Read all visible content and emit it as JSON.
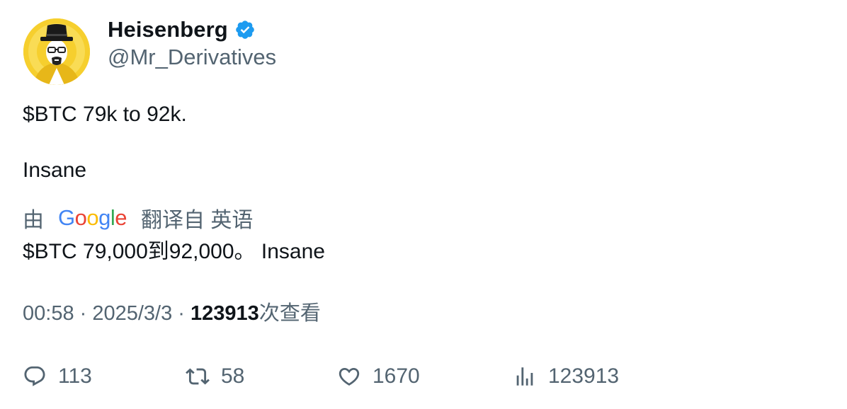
{
  "author": {
    "display_name": "Heisenberg",
    "handle": "@Mr_Derivatives",
    "verified": true,
    "verified_color": "#1d9bf0",
    "avatar_icon": "heisenberg-avatar"
  },
  "tweet": {
    "line1": "$BTC 79k to 92k.",
    "line2": "Insane"
  },
  "translation": {
    "prefix": "由",
    "provider": "Google",
    "provider_letters": [
      "G",
      "o",
      "o",
      "g",
      "l",
      "e"
    ],
    "provider_colors": [
      "#4285f4",
      "#ea4335",
      "#fbbc05",
      "#4285f4",
      "#34a853",
      "#ea4335"
    ],
    "suffix": "翻译自 英语",
    "text": "$BTC 79,000到92,000。 Insane"
  },
  "meta": {
    "time": "00:58",
    "separator1": " · ",
    "date": "2025/3/3",
    "separator2": " · ",
    "views": "123913",
    "views_label": "次查看"
  },
  "actions": {
    "replies": "113",
    "retweets": "58",
    "likes": "1670",
    "views": "123913"
  }
}
